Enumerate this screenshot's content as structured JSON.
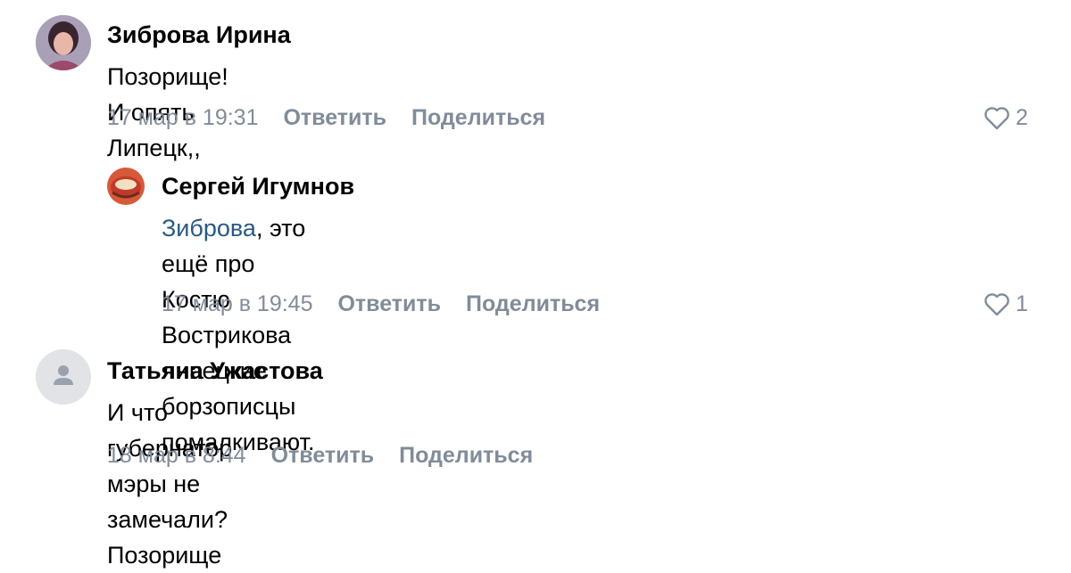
{
  "comments": [
    {
      "author": "Зиброва Ирина",
      "text": "Позорище! И опять Липецк,,",
      "date": "17 мар в 19:31",
      "reply_label": "Ответить",
      "share_label": "Поделиться",
      "likes": "2"
    },
    {
      "author": "Сергей Игумнов",
      "mention": "Зиброва",
      "text_line1": ", это ещё про Костю Вострикова липецкие борзописцы",
      "text_line2": "помалкивают.",
      "date": "17 мар в 19:45",
      "reply_label": "Ответить",
      "share_label": "Поделиться",
      "likes": "1"
    },
    {
      "author": "Татьяна Ужастова",
      "text": "И что губернатор мэры не замечали? Позорище",
      "date": "18 мар в 8:44",
      "reply_label": "Ответить",
      "share_label": "Поделиться"
    }
  ]
}
